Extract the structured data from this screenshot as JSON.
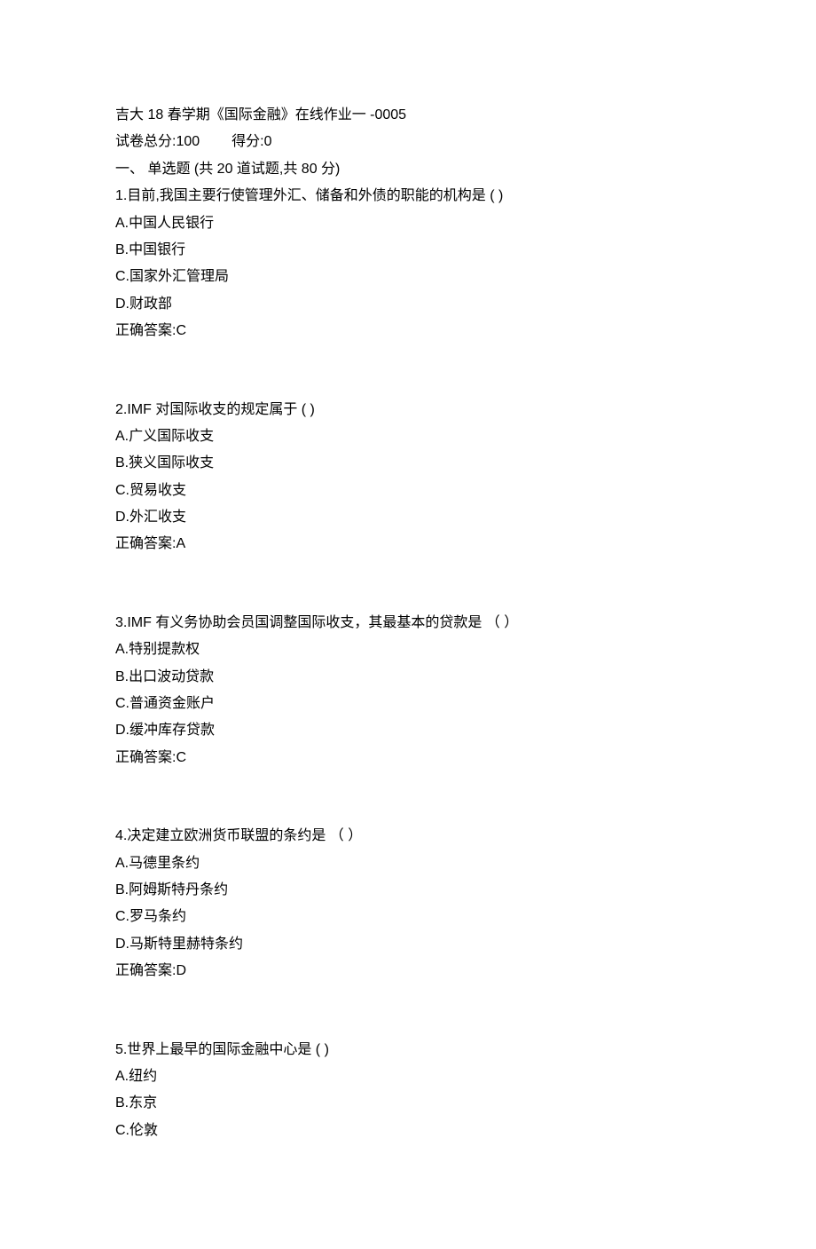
{
  "header": {
    "title": "吉大 18 春学期《国际金融》在线作业一  -0005",
    "scoreLabel": "试卷总分:",
    "scoreValue": "100",
    "obtainedLabel": "得分:",
    "obtainedValue": "0",
    "sectionTitle": "一、  单选题 (共 20 道试题,共 80 分)"
  },
  "questions": [
    {
      "number": "1.",
      "stem": "目前,我国主要行使管理外汇、储备和外债的职能的机构是 ( )",
      "options": {
        "a": "A.中国人民银行",
        "b": "B.中国银行",
        "c": "C.国家外汇管理局",
        "d": "D.财政部"
      },
      "answerLabel": "正确答案:",
      "answerValue": "C"
    },
    {
      "number": "2.",
      "stem": "IMF 对国际收支的规定属于 ( )",
      "options": {
        "a": "A.广义国际收支",
        "b": "B.狭义国际收支",
        "c": "C.贸易收支",
        "d": "D.外汇收支"
      },
      "answerLabel": "正确答案:",
      "answerValue": "A"
    },
    {
      "number": "3.",
      "stem": "IMF 有义务协助会员国调整国际收支，其最基本的贷款是 （ ）",
      "options": {
        "a": "A.特别提款权",
        "b": "B.出口波动贷款",
        "c": "C.普通资金账户",
        "d": "D.缓冲库存贷款"
      },
      "answerLabel": "正确答案:",
      "answerValue": "C"
    },
    {
      "number": "4.",
      "stem": "决定建立欧洲货币联盟的条约是 （ ）",
      "options": {
        "a": "A.马德里条约",
        "b": "B.阿姆斯特丹条约",
        "c": "C.罗马条约",
        "d": "D.马斯特里赫特条约"
      },
      "answerLabel": "正确答案:",
      "answerValue": "D"
    },
    {
      "number": "5.",
      "stem": "世界上最早的国际金融中心是 ( )",
      "options": {
        "a": "A.纽约",
        "b": "B.东京",
        "c": "C.伦敦"
      },
      "answerLabel": "",
      "answerValue": ""
    }
  ]
}
